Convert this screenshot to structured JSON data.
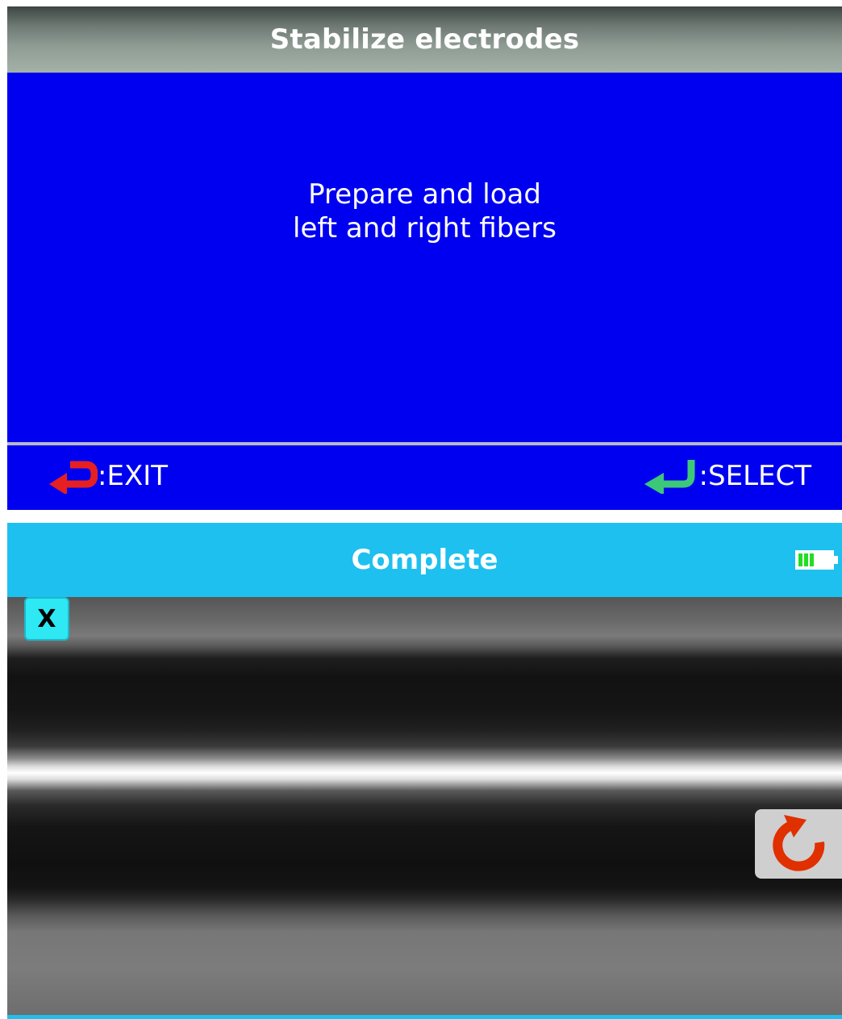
{
  "top_screen": {
    "title": "Stabilize electrodes",
    "message_line1": "Prepare and load",
    "message_line2": "left and right fibers",
    "exit_label": ":EXIT",
    "select_label": ":SELECT",
    "exit_icon": "return-arrow-icon",
    "select_icon": "enter-arrow-icon",
    "colors": {
      "background": "#0000f0",
      "exit_icon": "#e62020",
      "select_icon": "#3cc878"
    }
  },
  "bottom_screen": {
    "title": "Complete",
    "close_label": "X",
    "battery_level": 0.75,
    "battery_icon": "battery-icon",
    "redo_icon": "redo-icon",
    "colors": {
      "header": "#1ec0ef",
      "close_button": "#2ee8f4",
      "redo_icon": "#e03000",
      "battery_fill": "#22dd22"
    }
  }
}
